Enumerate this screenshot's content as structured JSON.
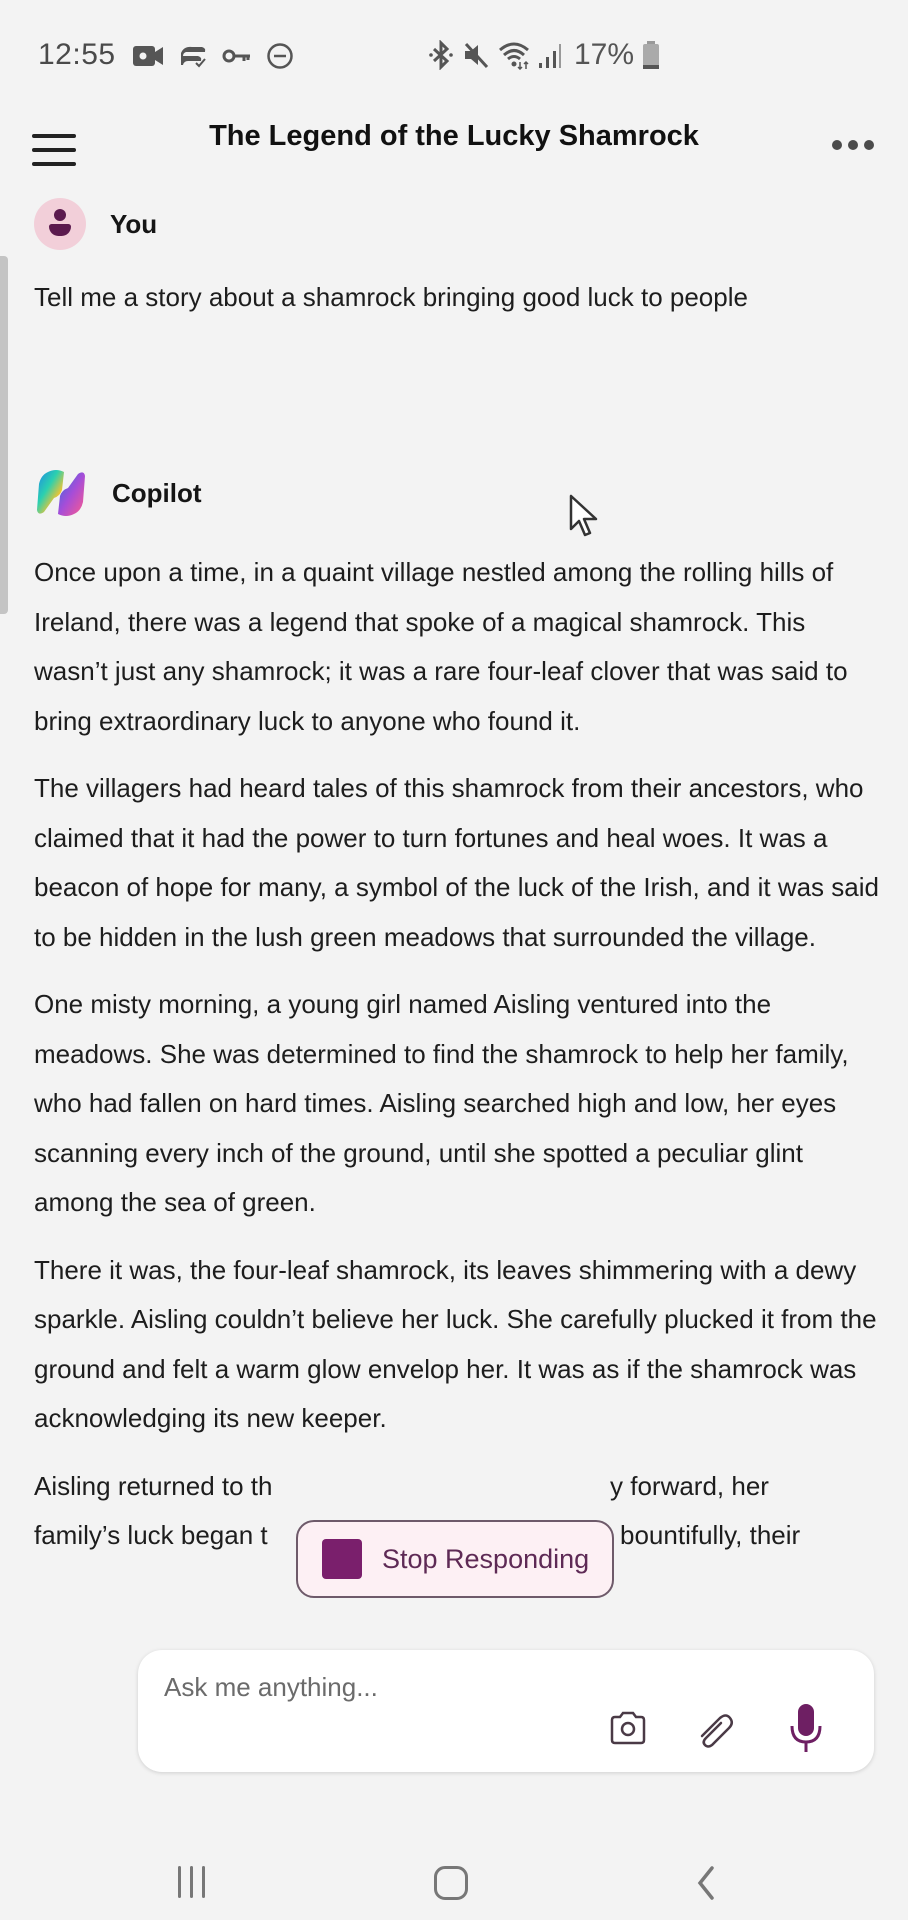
{
  "status_bar": {
    "time": "12:55",
    "left_icons": [
      "video-camera-icon",
      "cloud-sync-icon",
      "vpn-key-icon",
      "do-not-disturb-icon"
    ],
    "right_icons": [
      "bluetooth-icon",
      "mute-icon",
      "wifi-icon",
      "signal-icon",
      "battery-icon"
    ],
    "battery_percent": "17%"
  },
  "header": {
    "title": "The Legend of the Lucky Shamrock",
    "menu_icon": "hamburger-menu-icon",
    "more_icon": "more-options-icon"
  },
  "conversation": {
    "user": {
      "name": "You",
      "message": "Tell me a story about a shamrock bringing good luck to people"
    },
    "assistant": {
      "name": "Copilot",
      "paragraphs": [
        "Once upon a time, in a quaint village nestled among the rolling hills of Ireland, there was a legend that spoke of a magical shamrock. This wasn’t just any shamrock; it was a rare four-leaf clover that was said to bring extraordinary luck to anyone who found it.",
        "The villagers had heard tales of this shamrock from their ancestors, who claimed that it had the power to turn fortunes and heal woes. It was a beacon of hope for many, a symbol of the luck of the Irish, and it was said to be hidden in the lush green meadows that surrounded the village.",
        "One misty morning, a young girl named Aisling ventured into the meadows. She was determined to find the shamrock to help her family, who had fallen on hard times. Aisling searched high and low, her eyes scanning every inch of the ground, until she spotted a peculiar glint among the sea of green.",
        "There it was, the four-leaf shamrock, its leaves shimmering with a dewy sparkle. Aisling couldn’t believe her luck. She carefully plucked it from the ground and felt a warm glow envelop her. It was as if the shamrock was acknowledging its new keeper.",
        "Aisling returned to th… …y forward, her family’s luck began t… … bountifully, their"
      ],
      "partial_visible": {
        "line1_left": "Aisling returned to th",
        "line1_right": "y forward, her",
        "line2_left": "family’s luck began t",
        "line2_right": "bountifully, their"
      }
    }
  },
  "stop_button": {
    "label": "Stop Responding",
    "color": "#7a1f6c"
  },
  "composer": {
    "placeholder": "Ask me anything...",
    "value": "",
    "buttons": [
      "camera-icon",
      "attach-icon",
      "microphone-icon"
    ],
    "accent_color": "#6e1f63"
  },
  "nav_bar": {
    "buttons": [
      "recents-icon",
      "home-icon",
      "back-icon"
    ]
  }
}
